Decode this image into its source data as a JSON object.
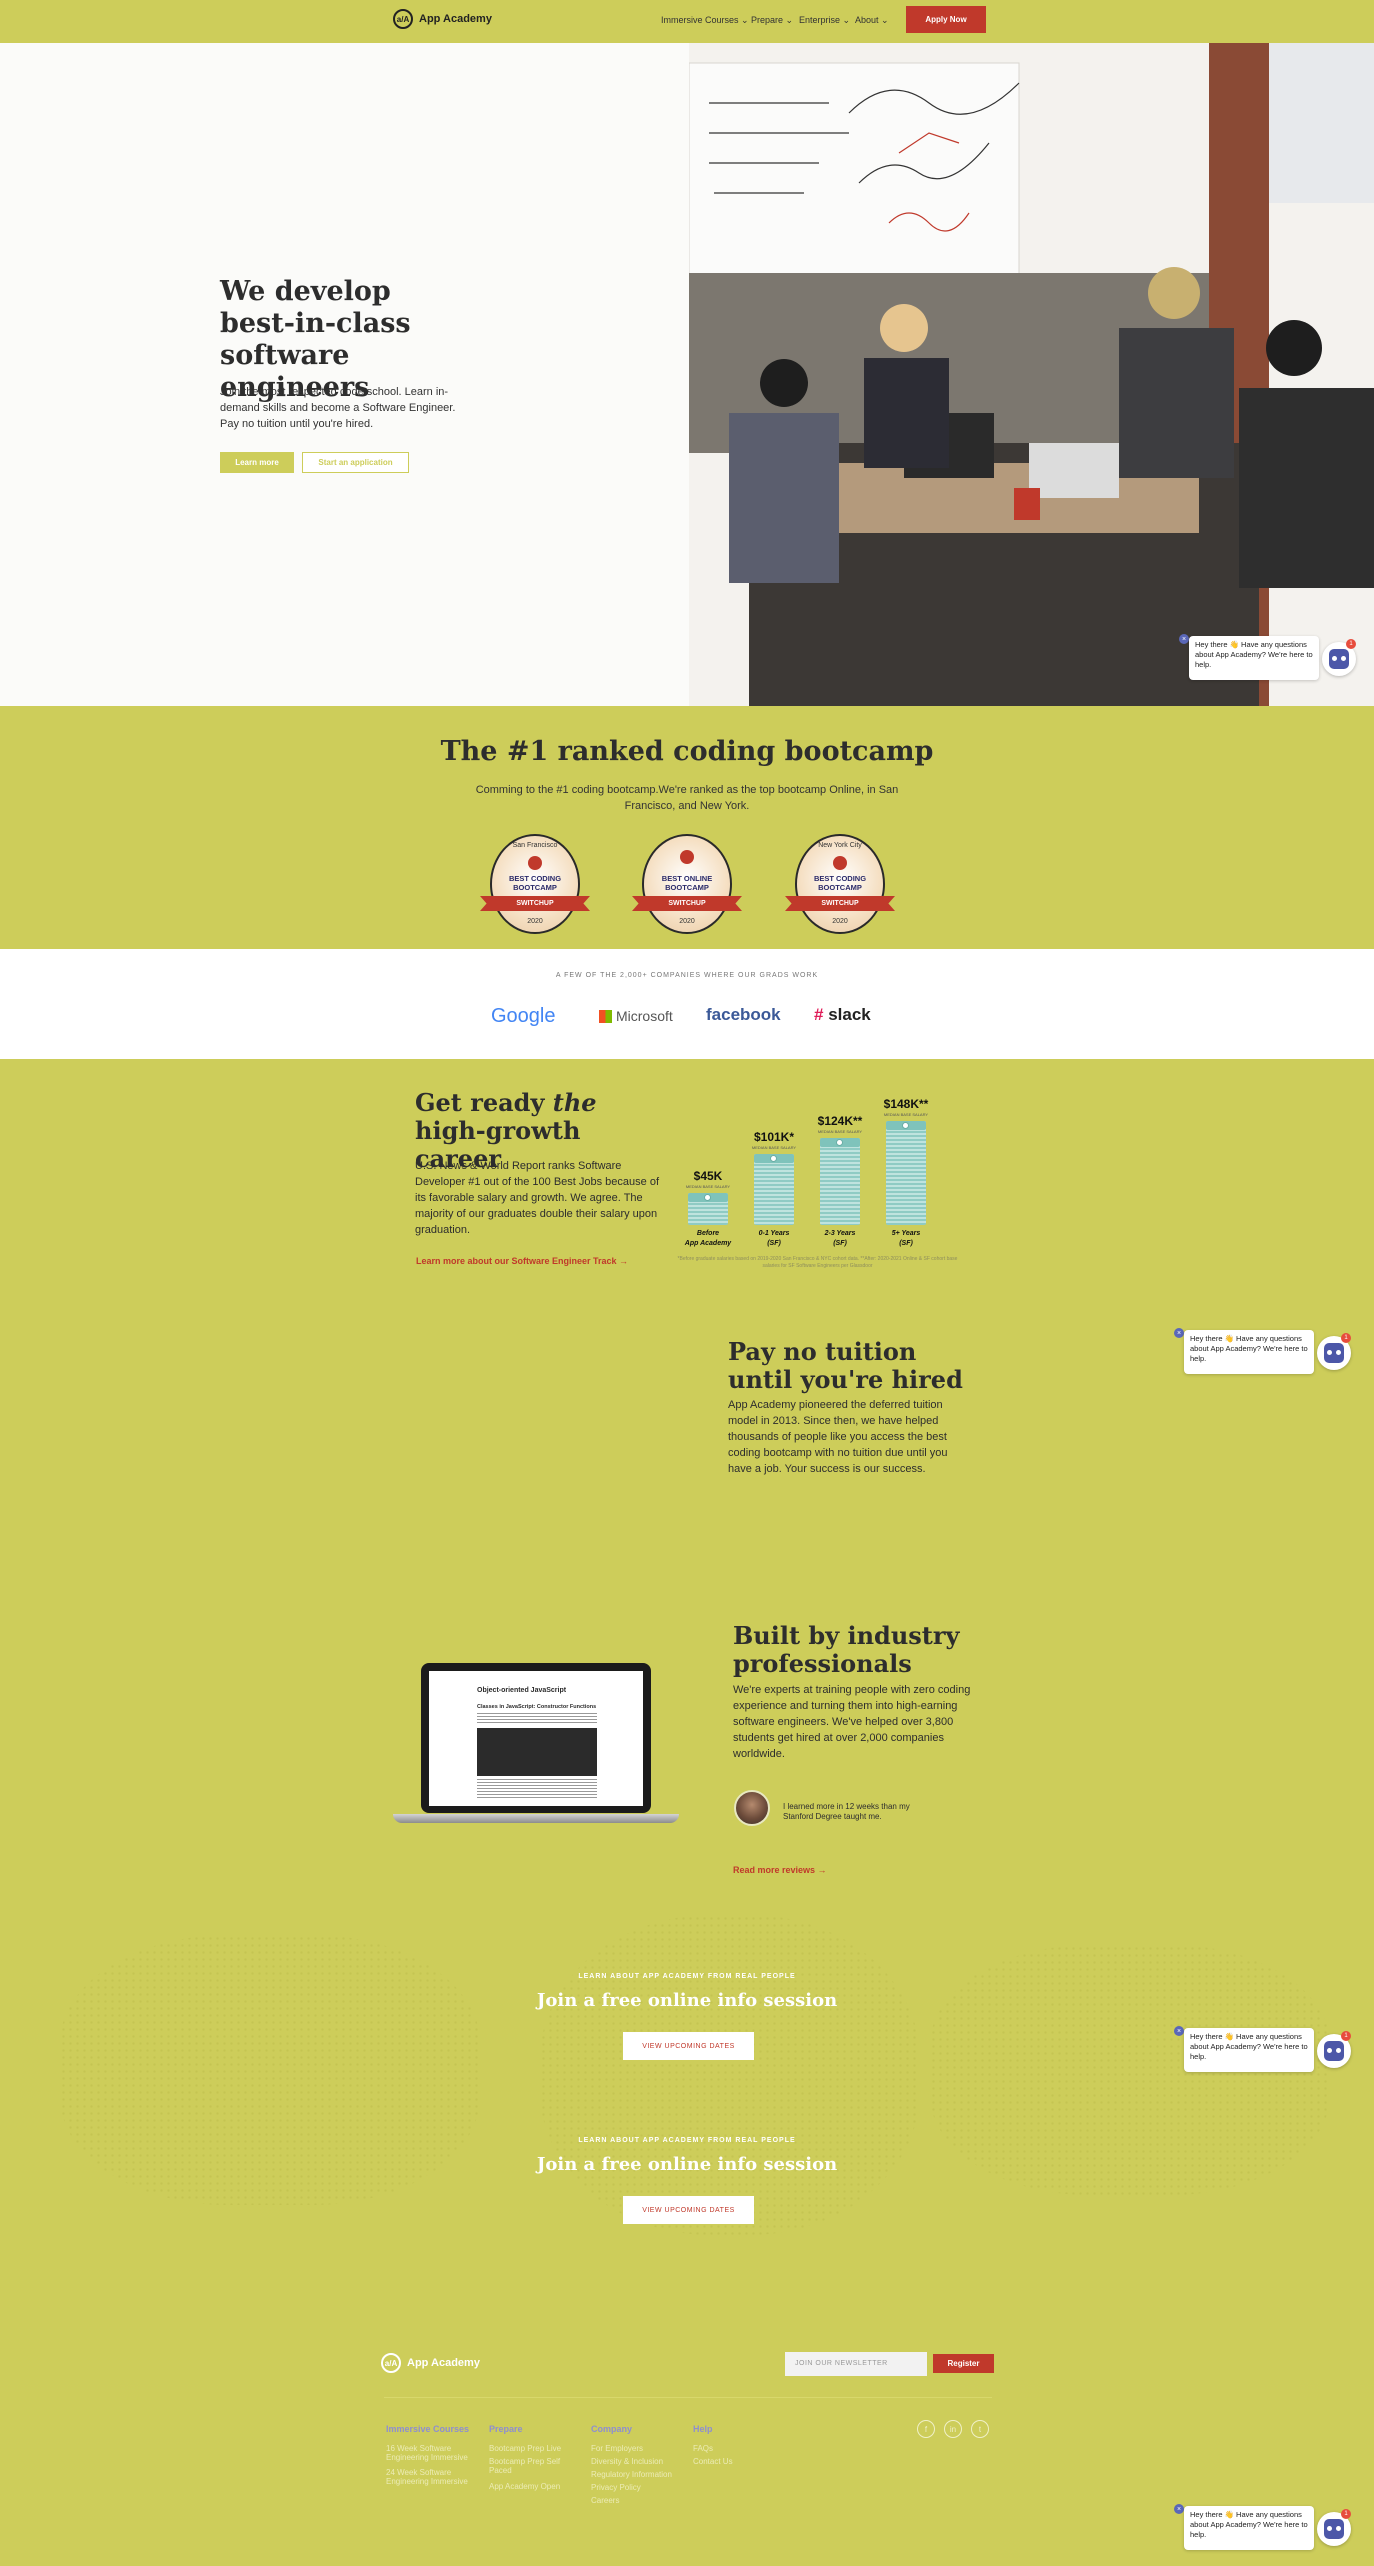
{
  "nav": {
    "logo_text": "App Academy",
    "logo_mark": "a/A",
    "links": [
      "Immersive Courses",
      "Prepare",
      "Enterprise",
      "About"
    ],
    "apply_label": "Apply Now"
  },
  "hero": {
    "title": "We develop best-in-class software engineers",
    "subtitle": "Join the most respected code school. Learn in-demand skills and become a Software Engineer. Pay no tuition until you're hired.",
    "learn_more": "Learn more",
    "start_application": "Start an application"
  },
  "ranked": {
    "title": "The #1 ranked coding bootcamp",
    "subtitle": "Comming to the #1 coding bootcamp.We're ranked as the top bootcamp Online, in San Francisco, and New York.",
    "badges": [
      {
        "top": "San Francisco",
        "line1": "BEST CODING",
        "line2": "BOOTCAMP",
        "ribbon": "SWITCHUP",
        "year": "2020"
      },
      {
        "top": "",
        "line1": "BEST ONLINE",
        "line2": "BOOTCAMP",
        "ribbon": "SWITCHUP",
        "year": "2020"
      },
      {
        "top": "New York City",
        "line1": "BEST CODING",
        "line2": "BOOTCAMP",
        "ribbon": "SWITCHUP",
        "year": "2020"
      }
    ]
  },
  "companies": {
    "caption": "A FEW OF THE 2,000+ COMPANIES WHERE OUR GRADS WORK",
    "logos": [
      "Google",
      "Microsoft",
      "facebook",
      "slack"
    ]
  },
  "career": {
    "title_pre": "Get ready ",
    "title_em": "the",
    "title_post": " high-growth career",
    "body": "U.S. News & World Report ranks Software Developer #1 out of the 100 Best Jobs because of its favorable salary and growth. We agree. The majority of our graduates double their salary upon graduation.",
    "link": "Learn more about our Software Engineer Track →",
    "salary_sub": "MEDIAN BASE SALARY",
    "footnote": "*Before graduate salaries based on 2019-2020 San Francisco & NYC cohort data. **After: 2020-2021 Online & SF cohort base salaries for SF Software Engineers per Glassdoor"
  },
  "chart_data": {
    "type": "bar",
    "categories": [
      "Before App Academy",
      "0-1 Years (SF)",
      "2-3 Years (SF)",
      "5+ Years (SF)"
    ],
    "values": [
      45,
      101,
      124,
      148
    ],
    "labels": [
      "$45K",
      "$101K*",
      "$124K**",
      "$148K**"
    ],
    "category_lines": [
      [
        "Before",
        "App Academy"
      ],
      [
        "0-1 Years",
        "(SF)"
      ],
      [
        "2-3 Years",
        "(SF)"
      ],
      [
        "5+ Years",
        "(SF)"
      ]
    ],
    "ylim": [
      0,
      150
    ]
  },
  "tuition": {
    "title": "Pay no tuition until you're hired",
    "body": "App Academy pioneered the deferred tuition model in 2013. Since then, we have helped thousands of people like you access the best coding bootcamp with no tuition due until you have a job. Your success is our success."
  },
  "industry": {
    "title": "Built by industry professionals",
    "body": "We're experts at training people with zero coding experience and turning them into high-earning software engineers. We've helped over 3,800 students get hired at over 2,000 companies worldwide.",
    "quote": "I learned more in 12 weeks than my Stanford Degree taught me.",
    "link": "Read more reviews →",
    "laptop_heading": "Object-oriented JavaScript",
    "laptop_subheading": "Classes in JavaScript: Constructor Functions"
  },
  "info": {
    "eyebrow": "LEARN ABOUT APP ACADEMY FROM REAL PEOPLE",
    "title": "Join a free online info session",
    "button": "VIEW UPCOMING DATES"
  },
  "footer": {
    "logo_text": "App Academy",
    "newsletter_placeholder": "JOIN OUR NEWSLETTER",
    "register": "Register",
    "columns": [
      {
        "head": "Immersive Courses",
        "links": [
          "16 Week Software Engineering Immersive",
          "24 Week Software Engineering Immersive"
        ]
      },
      {
        "head": "Prepare",
        "links": [
          "Bootcamp Prep Live",
          "Bootcamp Prep Self Paced",
          "App Academy Open"
        ]
      },
      {
        "head": "Company",
        "links": [
          "For Employers",
          "Diversity & Inclusion",
          "Regulatory Information",
          "Privacy Policy",
          "Careers"
        ]
      },
      {
        "head": "Help",
        "links": [
          "FAQs",
          "Contact Us"
        ]
      }
    ],
    "social": [
      "f",
      "in",
      "t"
    ]
  },
  "chat": {
    "message": "Hey there 👋 Have any questions about App Academy? We're here to help.",
    "count": "1"
  },
  "colors": {
    "brand": "#cdcd5a",
    "accent": "#c0392b"
  }
}
